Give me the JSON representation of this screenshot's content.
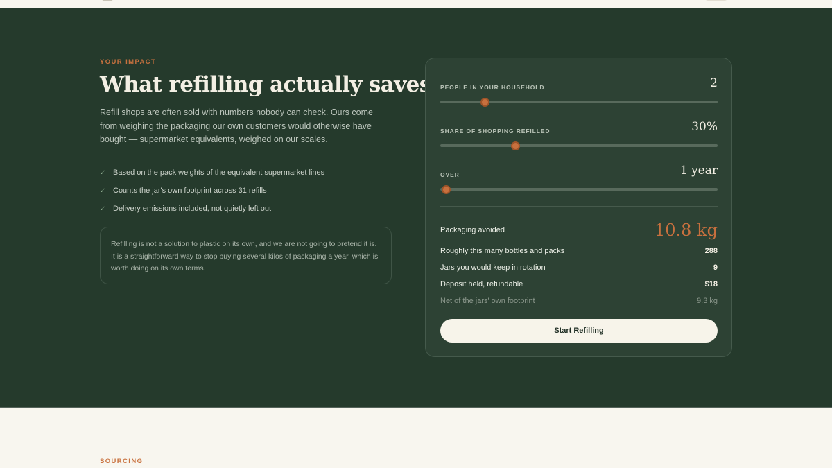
{
  "impact": {
    "eyebrow": "YOUR IMPACT",
    "headline": "What refilling actually saves",
    "lede": "Refill shops are often sold with numbers nobody can check. Ours come from weighing the packaging our own customers would otherwise have bought — supermarket equivalents, weighed on our scales.",
    "bullets": [
      "Based on the pack weights of the equivalent supermarket lines",
      "Counts the jar's own footprint across 31 refills",
      "Delivery emissions included, not quietly left out"
    ],
    "check_icon": "✓",
    "note": "Refilling is not a solution to plastic on its own, and we are not going to pretend it is. It is a straightforward way to stop buying several kilos of packaging a year, which is worth doing on its own terms."
  },
  "calculator": {
    "controls": [
      {
        "label": "PEOPLE IN YOUR HOUSEHOLD",
        "value": "2",
        "fraction": 0.16
      },
      {
        "label": "SHARE OF SHOPPING REFILLED",
        "value": "30%",
        "fraction": 0.27
      },
      {
        "label": "OVER",
        "value": "1 year",
        "fraction": 0.02
      }
    ],
    "results": [
      {
        "label": "Packaging avoided",
        "value": "10.8 kg"
      },
      {
        "label": "Roughly this many bottles and packs",
        "value": "288"
      },
      {
        "label": "Jars you would keep in rotation",
        "value": "9"
      },
      {
        "label": "Deposit held, refundable",
        "value": "$18"
      },
      {
        "label": "Net of the jars' own footprint",
        "value": "9.3 kg"
      }
    ],
    "cta": "Start Refilling"
  },
  "sourcing": {
    "eyebrow": "SOURCING"
  },
  "colors": {
    "section_bg": "#253a2c",
    "card_bg": "#2d4234",
    "accent": "#c8703e",
    "page_bg": "#f8f6ef"
  }
}
